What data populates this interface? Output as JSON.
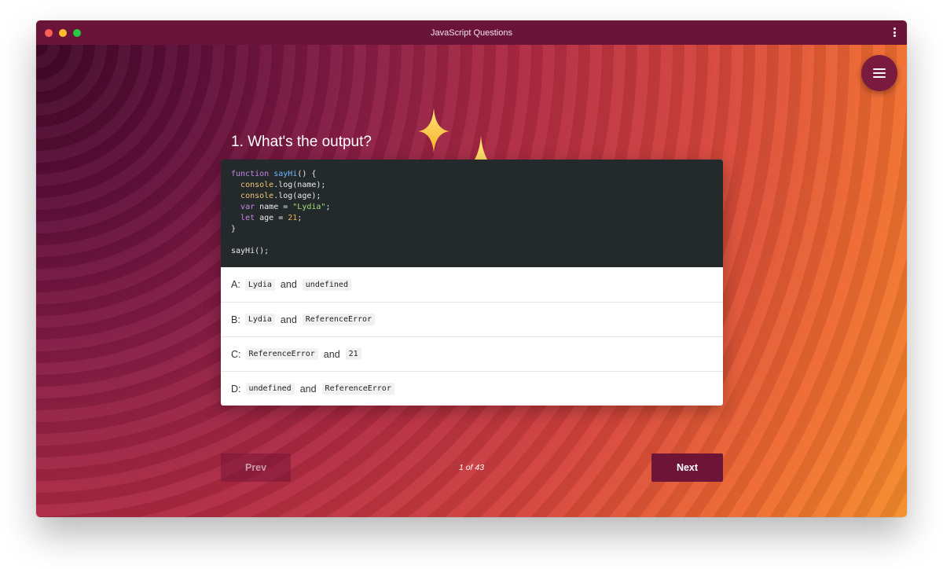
{
  "window": {
    "title": "JavaScript Questions"
  },
  "question": {
    "title": "1. What's the output?"
  },
  "code_lines": [
    [
      {
        "t": "function",
        "c": "kw"
      },
      {
        "t": " "
      },
      {
        "t": "sayHi",
        "c": "fn"
      },
      {
        "t": "() {"
      }
    ],
    [
      {
        "t": "  "
      },
      {
        "t": "console",
        "c": "obj"
      },
      {
        "t": ".log(name);"
      }
    ],
    [
      {
        "t": "  "
      },
      {
        "t": "console",
        "c": "obj"
      },
      {
        "t": ".log(age);"
      }
    ],
    [
      {
        "t": "  "
      },
      {
        "t": "var",
        "c": "kw"
      },
      {
        "t": " name = "
      },
      {
        "t": "\"Lydia\"",
        "c": "str"
      },
      {
        "t": ";"
      }
    ],
    [
      {
        "t": "  "
      },
      {
        "t": "let",
        "c": "kw"
      },
      {
        "t": " age = "
      },
      {
        "t": "21",
        "c": "num"
      },
      {
        "t": ";"
      }
    ],
    [
      {
        "t": "}"
      }
    ],
    [
      {
        "t": ""
      }
    ],
    [
      {
        "t": "sayHi();"
      }
    ]
  ],
  "options": [
    {
      "letter": "A:",
      "first": "Lydia",
      "and": "and",
      "second": "undefined"
    },
    {
      "letter": "B:",
      "first": "Lydia",
      "and": "and",
      "second": "ReferenceError"
    },
    {
      "letter": "C:",
      "first": "ReferenceError",
      "and": "and",
      "second": "21"
    },
    {
      "letter": "D:",
      "first": "undefined",
      "and": "and",
      "second": "ReferenceError"
    }
  ],
  "nav": {
    "prev_label": "Prev",
    "next_label": "Next",
    "pager": "1 of 43"
  },
  "icons": {
    "menu": "hamburger-menu-icon",
    "more": "vertical-dots-icon",
    "decoration": "sparkles-icon"
  },
  "colors": {
    "titlebar": "#6b1439",
    "next_button": "#6e1436",
    "code_background": "#24292c"
  }
}
